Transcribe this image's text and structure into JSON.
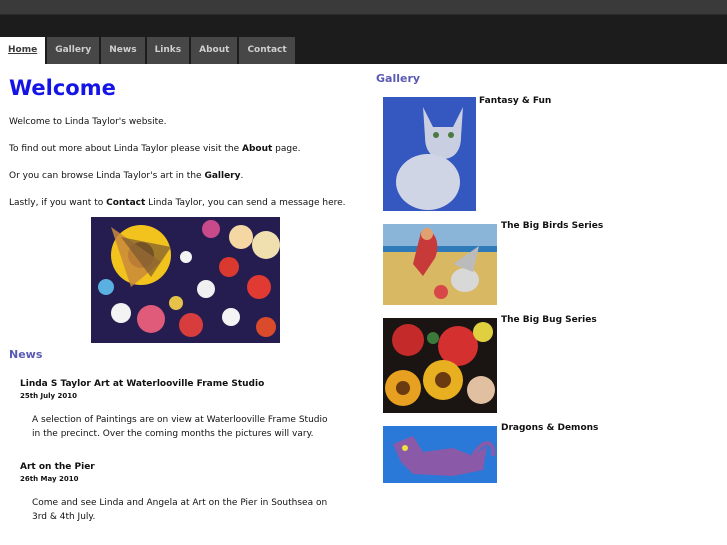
{
  "nav": {
    "items": [
      {
        "label": "Home",
        "active": true
      },
      {
        "label": "Gallery"
      },
      {
        "label": "News"
      },
      {
        "label": "Links"
      },
      {
        "label": "About"
      },
      {
        "label": "Contact"
      }
    ]
  },
  "welcome": {
    "title": "Welcome",
    "p1": "Welcome to Linda Taylor's website.",
    "p2_pre": "To find out more about Linda Taylor please visit the ",
    "p2_link": "About",
    "p2_post": " page.",
    "p3_pre": "Or you can browse Linda Taylor's art in the ",
    "p3_link": "Gallery",
    "p3_post": ".",
    "p4_pre": "Lastly, if you want to ",
    "p4_link": "Contact",
    "p4_post": " Linda Taylor, you can send a message here."
  },
  "news": {
    "heading": "News",
    "items": [
      {
        "title": "Linda S Taylor Art at Waterlooville Frame Studio",
        "date": "25th July 2010",
        "body": "A selection of Paintings are on view at Waterlooville Frame Studio in the precinct. Over the coming months the pictures will vary."
      },
      {
        "title": "Art on the Pier",
        "date": "26th May 2010",
        "body": "Come and see Linda and Angela at Art on the Pier in Southsea on 3rd & 4th July."
      }
    ]
  },
  "gallery": {
    "heading": "Gallery",
    "items": [
      {
        "label": "Fantasy & Fun"
      },
      {
        "label": "The Big Birds Series"
      },
      {
        "label": "The Big Bug Series"
      },
      {
        "label": "Dragons & Demons"
      }
    ]
  }
}
